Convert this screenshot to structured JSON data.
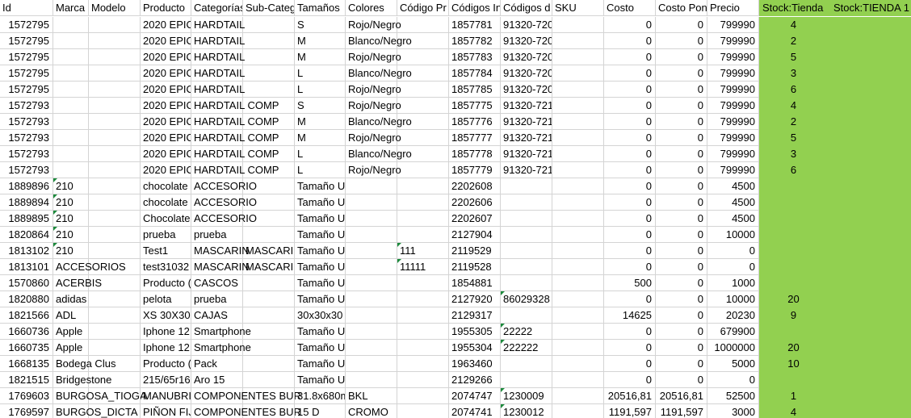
{
  "headers": {
    "c0": "Id",
    "c1": "Marca",
    "c2": "Modelo",
    "c3": "Producto",
    "c4": "Categorías",
    "c5": "Sub-Categ",
    "c6": "Tamaños",
    "c7": "Colores",
    "c8": "Código Pr",
    "c9": "Códigos In",
    "c10": "Códigos d",
    "c11": "SKU",
    "c12": "Costo",
    "c13": "Costo Pon",
    "c14": "Precio",
    "c15": "Stock:Tienda",
    "c16": "Stock:TIENDA 1"
  },
  "rows": [
    {
      "c0": "1572795",
      "c1": "",
      "c2": "",
      "c3": "2020 EPIC",
      "c4": "HARDTAIL",
      "c5": "",
      "c6": "S",
      "c7": "Rojo/Negro",
      "c8": "",
      "c9": "1857781",
      "c10": "91320-720",
      "c11": "",
      "c12": "0",
      "c13": "0",
      "c14": "799990",
      "c15": "4",
      "c16": ""
    },
    {
      "c0": "1572795",
      "c1": "",
      "c2": "",
      "c3": "2020 EPIC",
      "c4": "HARDTAIL",
      "c5": "",
      "c6": "M",
      "c7": "Blanco/Negro",
      "c8": "",
      "c9": "1857782",
      "c10": "91320-720",
      "c11": "",
      "c12": "0",
      "c13": "0",
      "c14": "799990",
      "c15": "2",
      "c16": ""
    },
    {
      "c0": "1572795",
      "c1": "",
      "c2": "",
      "c3": "2020 EPIC",
      "c4": "HARDTAIL",
      "c5": "",
      "c6": "M",
      "c7": "Rojo/Negro",
      "c8": "",
      "c9": "1857783",
      "c10": "91320-720",
      "c11": "",
      "c12": "0",
      "c13": "0",
      "c14": "799990",
      "c15": "5",
      "c16": ""
    },
    {
      "c0": "1572795",
      "c1": "",
      "c2": "",
      "c3": "2020 EPIC",
      "c4": "HARDTAIL",
      "c5": "",
      "c6": "L",
      "c7": "Blanco/Negro",
      "c8": "",
      "c9": "1857784",
      "c10": "91320-720",
      "c11": "",
      "c12": "0",
      "c13": "0",
      "c14": "799990",
      "c15": "3",
      "c16": ""
    },
    {
      "c0": "1572795",
      "c1": "",
      "c2": "",
      "c3": "2020 EPIC",
      "c4": "HARDTAIL",
      "c5": "",
      "c6": "L",
      "c7": "Rojo/Negro",
      "c8": "",
      "c9": "1857785",
      "c10": "91320-720",
      "c11": "",
      "c12": "0",
      "c13": "0",
      "c14": "799990",
      "c15": "6",
      "c16": ""
    },
    {
      "c0": "1572793",
      "c1": "",
      "c2": "",
      "c3": "2020 EPIC",
      "c4": "HARDTAIL COMP",
      "c5": "",
      "c6": "S",
      "c7": "Rojo/Negro",
      "c8": "",
      "c9": "1857775",
      "c10": "91320-721",
      "c11": "",
      "c12": "0",
      "c13": "0",
      "c14": "799990",
      "c15": "4",
      "c16": ""
    },
    {
      "c0": "1572793",
      "c1": "",
      "c2": "",
      "c3": "2020 EPIC",
      "c4": "HARDTAIL COMP",
      "c5": "",
      "c6": "M",
      "c7": "Blanco/Negro",
      "c8": "",
      "c9": "1857776",
      "c10": "91320-721",
      "c11": "",
      "c12": "0",
      "c13": "0",
      "c14": "799990",
      "c15": "2",
      "c16": ""
    },
    {
      "c0": "1572793",
      "c1": "",
      "c2": "",
      "c3": "2020 EPIC",
      "c4": "HARDTAIL COMP",
      "c5": "",
      "c6": "M",
      "c7": "Rojo/Negro",
      "c8": "",
      "c9": "1857777",
      "c10": "91320-721",
      "c11": "",
      "c12": "0",
      "c13": "0",
      "c14": "799990",
      "c15": "5",
      "c16": ""
    },
    {
      "c0": "1572793",
      "c1": "",
      "c2": "",
      "c3": "2020 EPIC",
      "c4": "HARDTAIL COMP",
      "c5": "",
      "c6": "L",
      "c7": "Blanco/Negro",
      "c8": "",
      "c9": "1857778",
      "c10": "91320-721",
      "c11": "",
      "c12": "0",
      "c13": "0",
      "c14": "799990",
      "c15": "3",
      "c16": ""
    },
    {
      "c0": "1572793",
      "c1": "",
      "c2": "",
      "c3": "2020 EPIC",
      "c4": "HARDTAIL COMP",
      "c5": "",
      "c6": "L",
      "c7": "Rojo/Negro",
      "c8": "",
      "c9": "1857779",
      "c10": "91320-721",
      "c11": "",
      "c12": "0",
      "c13": "0",
      "c14": "799990",
      "c15": "6",
      "c16": ""
    },
    {
      "c0": "1889896",
      "c1": "210",
      "c2": "",
      "c3": "chocolate",
      "c4": "ACCESORIO",
      "c5": "",
      "c6": "Tamaño U",
      "c7": "",
      "c8": "",
      "c9": "2202608",
      "c10": "",
      "c11": "",
      "c12": "0",
      "c13": "0",
      "c14": "4500",
      "c15": "",
      "c16": ""
    },
    {
      "c0": "1889894",
      "c1": "210",
      "c2": "",
      "c3": "chocolate",
      "c4": "ACCESORIO",
      "c5": "",
      "c6": "Tamaño U",
      "c7": "",
      "c8": "",
      "c9": "2202606",
      "c10": "",
      "c11": "",
      "c12": "0",
      "c13": "0",
      "c14": "4500",
      "c15": "",
      "c16": ""
    },
    {
      "c0": "1889895",
      "c1": "210",
      "c2": "",
      "c3": "Chocolate",
      "c4": "ACCESORIO",
      "c5": "",
      "c6": "Tamaño U",
      "c7": "",
      "c8": "",
      "c9": "2202607",
      "c10": "",
      "c11": "",
      "c12": "0",
      "c13": "0",
      "c14": "4500",
      "c15": "",
      "c16": ""
    },
    {
      "c0": "1820864",
      "c1": "210",
      "c2": "",
      "c3": "prueba",
      "c4": "prueba",
      "c5": "",
      "c6": "Tamaño U",
      "c7": "",
      "c8": "",
      "c9": "2127904",
      "c10": "",
      "c11": "",
      "c12": "0",
      "c13": "0",
      "c14": "10000",
      "c15": "",
      "c16": ""
    },
    {
      "c0": "1813102",
      "c1": "210",
      "c2": "",
      "c3": "Test1",
      "c4": "MASCARIN",
      "c5": "MASCARIL",
      "c6": "Tamaño U",
      "c7": "",
      "c8": "111",
      "c9": "2119529",
      "c10": "",
      "c11": "",
      "c12": "0",
      "c13": "0",
      "c14": "0",
      "c15": "",
      "c16": ""
    },
    {
      "c0": "1813101",
      "c1": "ACCESORIOS",
      "c2": "",
      "c3": "test31032",
      "c4": "MASCARIN",
      "c5": "MASCARIL",
      "c6": "Tamaño U",
      "c7": "",
      "c8": "11111",
      "c9": "2119528",
      "c10": "",
      "c11": "",
      "c12": "0",
      "c13": "0",
      "c14": "0",
      "c15": "",
      "c16": ""
    },
    {
      "c0": "1570860",
      "c1": "ACERBIS",
      "c2": "",
      "c3": "Producto (",
      "c4": "CASCOS",
      "c5": "",
      "c6": "Tamaño U",
      "c7": "",
      "c8": "",
      "c9": "1854881",
      "c10": "",
      "c11": "",
      "c12": "500",
      "c13": "0",
      "c14": "1000",
      "c15": "",
      "c16": ""
    },
    {
      "c0": "1820880",
      "c1": "adidas",
      "c2": "",
      "c3": "pelota",
      "c4": "prueba",
      "c5": "",
      "c6": "Tamaño U",
      "c7": "",
      "c8": "",
      "c9": "2127920",
      "c10": "86029328",
      "c11": "",
      "c12": "0",
      "c13": "0",
      "c14": "10000",
      "c15": "20",
      "c16": ""
    },
    {
      "c0": "1821566",
      "c1": "ADL",
      "c2": "",
      "c3": "XS 30X30X",
      "c4": "CAJAS",
      "c5": "",
      "c6": "30x30x30",
      "c7": "",
      "c8": "",
      "c9": "2129317",
      "c10": "",
      "c11": "",
      "c12": "14625",
      "c13": "0",
      "c14": "20230",
      "c15": "9",
      "c16": ""
    },
    {
      "c0": "1660736",
      "c1": "Apple",
      "c2": "",
      "c3": "Iphone 12",
      "c4": "Smartphone",
      "c5": "",
      "c6": "Tamaño U",
      "c7": "",
      "c8": "",
      "c9": "1955305",
      "c10": "22222",
      "c11": "",
      "c12": "0",
      "c13": "0",
      "c14": "679900",
      "c15": "",
      "c16": ""
    },
    {
      "c0": "1660735",
      "c1": "Apple",
      "c2": "",
      "c3": "Iphone 12",
      "c4": "Smartphone",
      "c5": "",
      "c6": "Tamaño U",
      "c7": "",
      "c8": "",
      "c9": "1955304",
      "c10": "222222",
      "c11": "",
      "c12": "0",
      "c13": "0",
      "c14": "1000000",
      "c15": "20",
      "c16": ""
    },
    {
      "c0": "1668135",
      "c1": "Bodega Clus",
      "c2": "",
      "c3": "Producto (",
      "c4": "Pack",
      "c5": "",
      "c6": "Tamaño U",
      "c7": "",
      "c8": "",
      "c9": "1963460",
      "c10": "",
      "c11": "",
      "c12": "0",
      "c13": "0",
      "c14": "5000",
      "c15": "10",
      "c16": ""
    },
    {
      "c0": "1821515",
      "c1": "Bridgestone",
      "c2": "",
      "c3": "215/65r16",
      "c4": "Aro 15",
      "c5": "",
      "c6": "Tamaño U",
      "c7": "",
      "c8": "",
      "c9": "2129266",
      "c10": "",
      "c11": "",
      "c12": "0",
      "c13": "0",
      "c14": "0",
      "c15": "",
      "c16": ""
    },
    {
      "c0": "1769603",
      "c1": "BURGOSA_TIOGA",
      "c2": "",
      "c3": "MANUBRI",
      "c4": "COMPONENTES BUR",
      "c5": "",
      "c6": "31.8x680m",
      "c7": "BKL",
      "c8": "",
      "c9": "2074747",
      "c10": "1230009",
      "c11": "",
      "c12": "20516,81",
      "c13": "20516,81",
      "c14": "52500",
      "c15": "1",
      "c16": ""
    },
    {
      "c0": "1769597",
      "c1": "BURGOS_DICTA",
      "c2": "",
      "c3": "PIÑON FIJ",
      "c4": "COMPONENTES BUR",
      "c5": "",
      "c6": "15 D",
      "c7": "CROMO",
      "c8": "",
      "c9": "2074741",
      "c10": "1230012",
      "c11": "",
      "c12": "1191,597",
      "c13": "1191,597",
      "c14": "3000",
      "c15": "4",
      "c16": ""
    }
  ]
}
